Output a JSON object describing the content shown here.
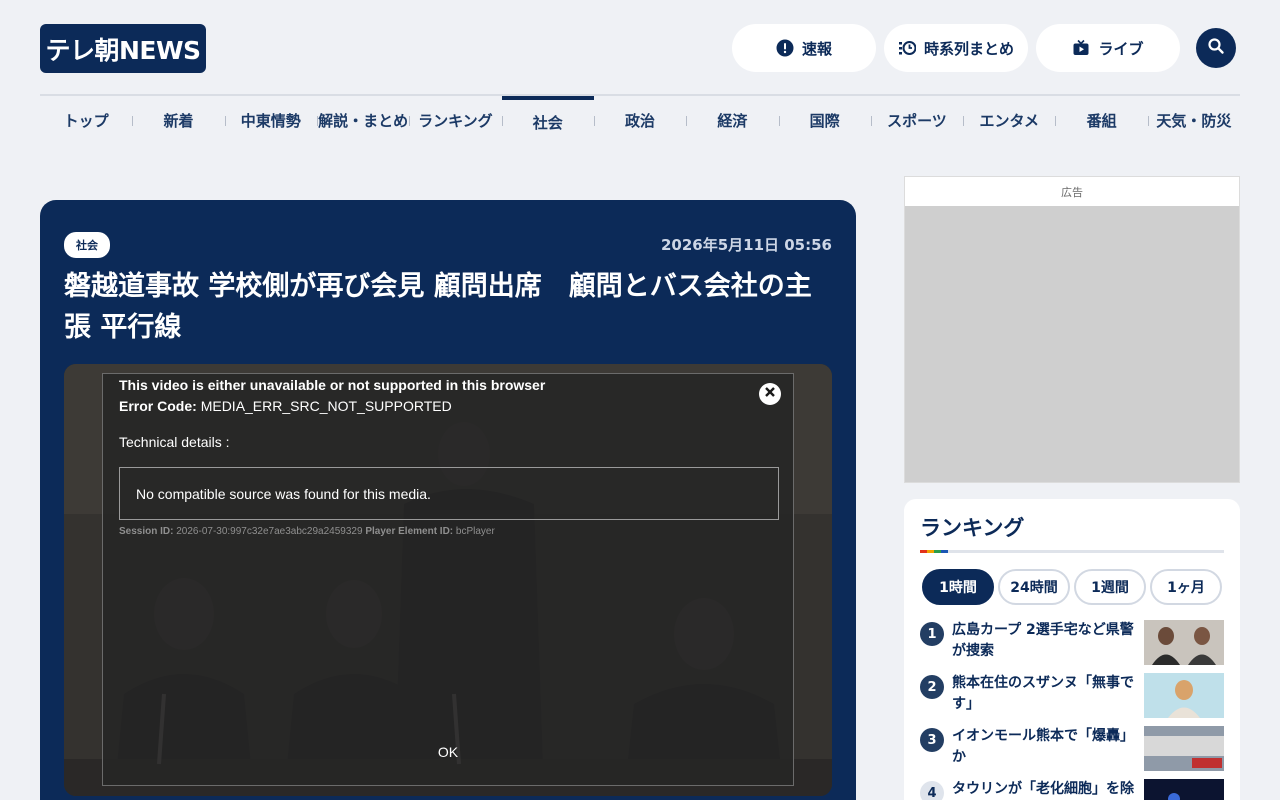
{
  "header": {
    "logo": "テレ朝NEWS",
    "breaking_label": "速報",
    "timeline_label": "時系列まとめ",
    "live_label": "ライブ"
  },
  "nav": {
    "items": [
      "トップ",
      "新着",
      "中東情勢",
      "解説・まとめ",
      "ランキング",
      "社会",
      "政治",
      "経済",
      "国際",
      "スポーツ",
      "エンタメ",
      "番組",
      "天気・防災"
    ],
    "active": "社会"
  },
  "article": {
    "category": "社会",
    "date": "2026年5月11日 05:56",
    "headline": "磐越道事故 学校側が再び会見 顧問出席　顧問とバス会社の主張 平行線"
  },
  "video_error": {
    "title": "This video is either unavailable or not supported in this browser",
    "code_label": "Error Code:",
    "code_value": "MEDIA_ERR_SRC_NOT_SUPPORTED",
    "tech_label": "Technical details :",
    "message": "No compatible source was found for this media.",
    "session_label": "Session ID:",
    "session_value": "2026-07-30:997c32e7ae3abc29a2459329",
    "element_label": "Player Element ID:",
    "element_value": "bcPlayer",
    "ok_label": "OK"
  },
  "ad": {
    "label": "広告"
  },
  "ranking": {
    "title": "ランキング",
    "tabs": [
      "1時間",
      "24時間",
      "1週間",
      "1ヶ月"
    ],
    "active_tab": "1時間",
    "items": [
      {
        "rank": "1",
        "text": "広島カープ 2選手宅など県警が捜索"
      },
      {
        "rank": "2",
        "text": "熊本在住のスザンヌ「無事です」"
      },
      {
        "rank": "3",
        "text": "イオンモール熊本で「爆轟」か"
      },
      {
        "rank": "4",
        "text": "タウリンが「老化細胞」を除去"
      }
    ]
  },
  "colors": {
    "brand": "#0c2a58",
    "background": "#eff1f5"
  }
}
